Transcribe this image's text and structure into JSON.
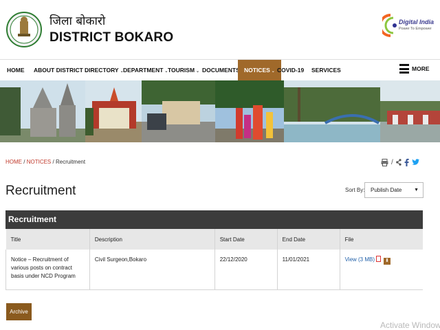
{
  "header": {
    "title_hindi": "जिला बोकारो",
    "title": "DISTRICT BOKARO",
    "digital_india_title": "Digital India",
    "digital_india_tagline": "Power To Empower"
  },
  "nav": {
    "items": [
      {
        "label": "HOME",
        "dropdown": false
      },
      {
        "label": "ABOUT DISTRICT",
        "dropdown": true
      },
      {
        "label": "DIRECTORY",
        "dropdown": true
      },
      {
        "label": "DEPARTMENT",
        "dropdown": true
      },
      {
        "label": "TOURISM",
        "dropdown": true
      },
      {
        "label": "DOCUMENTS",
        "dropdown": true
      },
      {
        "label": "NOTICES",
        "dropdown": true,
        "active": true
      },
      {
        "label": "COVID-19",
        "dropdown": false
      },
      {
        "label": "SERVICES",
        "dropdown": false
      }
    ],
    "more_label": "MORE",
    "chevron": "⌄"
  },
  "breadcrumb": {
    "home": "HOME",
    "notices": "NOTICES",
    "current": "Recruitment",
    "separator": "/"
  },
  "share": {
    "separator": "/"
  },
  "page_title": "Recruitment",
  "sort": {
    "label": "Sort By:",
    "selected": "Publish Date"
  },
  "table": {
    "title": "Recruitment",
    "columns": [
      "Title",
      "Description",
      "Start Date",
      "End Date",
      "File"
    ],
    "rows": [
      {
        "title": "Notice – Recruitment of various posts on contract basis under NCD Program",
        "description": "Civil Surgeon,Bokaro",
        "start_date": "22/12/2020",
        "end_date": "11/01/2021",
        "file_label": "View (3 MB)"
      }
    ]
  },
  "archive_label": "Archive",
  "watermark": "Activate Window",
  "colors": {
    "accent": "#a0692a",
    "table_header": "#3c3c3c",
    "link": "#1f5fa8"
  }
}
